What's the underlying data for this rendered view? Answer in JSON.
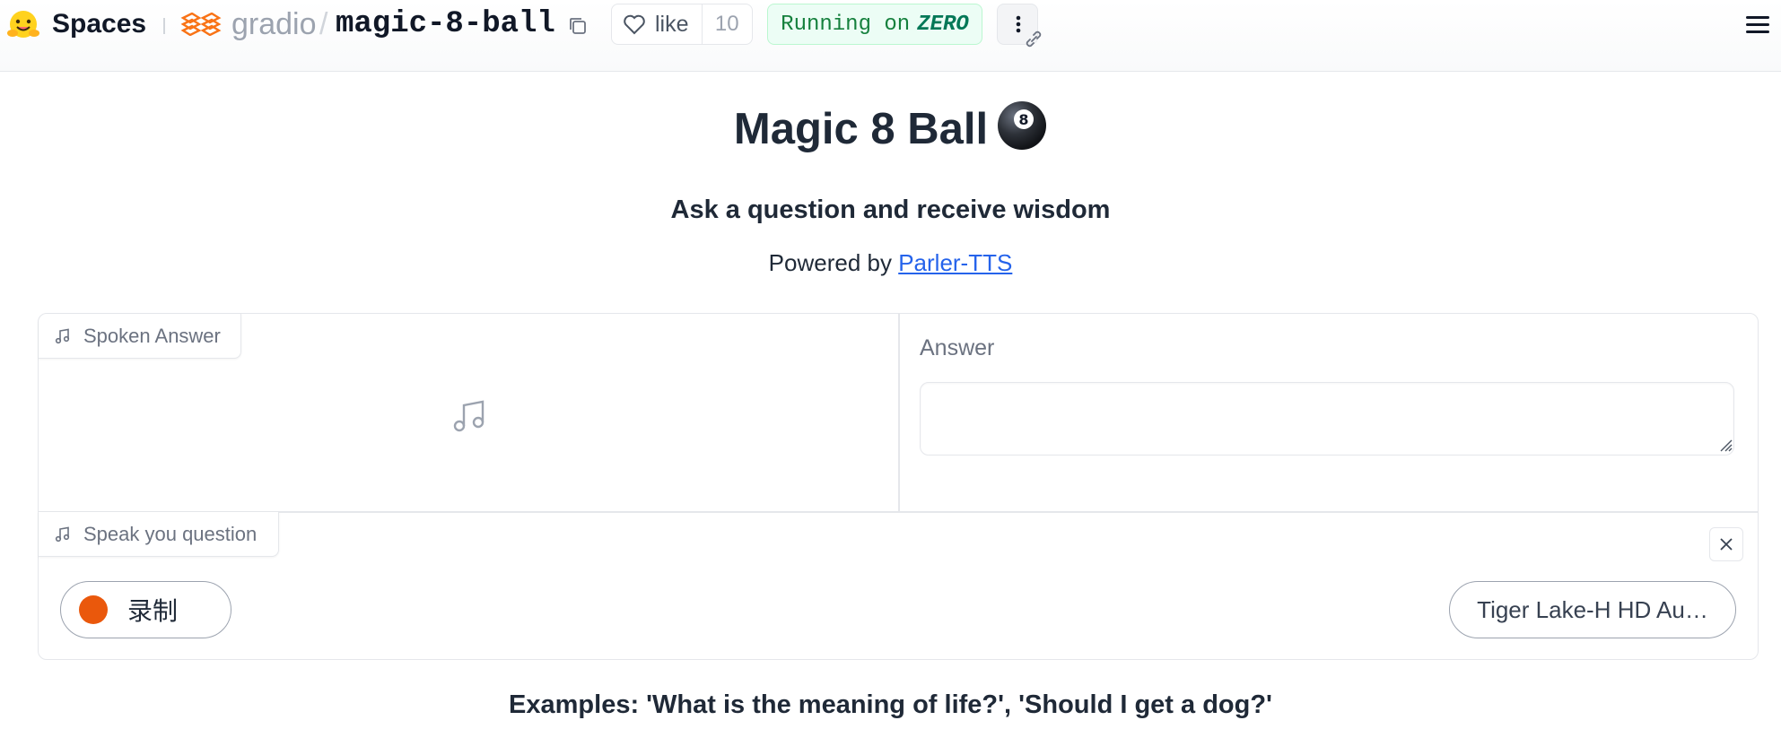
{
  "header": {
    "brand": "Spaces",
    "owner": "gradio",
    "separator": "/",
    "repo": "magic-8-ball",
    "like_label": "like",
    "like_count": "10",
    "status_prefix": "Running on",
    "status_hardware": "ZERO",
    "icons": [
      "hugging-face-logo",
      "org-logo-icon",
      "copy-icon",
      "heart-icon",
      "kebab-icon",
      "link-icon",
      "hamburger-icon"
    ]
  },
  "app": {
    "title": "Magic 8 Ball",
    "title_emoji": "8-ball-icon",
    "subtitle": "Ask a question and receive wisdom",
    "powered_prefix": "Powered by ",
    "powered_link": "Parler-TTS",
    "spoken_answer_label": "Spoken Answer",
    "answer_label": "Answer",
    "answer_value": "",
    "question_label": "Speak you question",
    "record_label": "录制",
    "device_label": "Tiger Lake-H HD Au…",
    "examples_text": "Examples: 'What is the meaning of life?', 'Should I get a dog?'"
  },
  "colors": {
    "accent_orange": "#ea580c",
    "link_blue": "#2563eb",
    "status_green": "#15803d",
    "status_bg": "#ecfdf5"
  }
}
